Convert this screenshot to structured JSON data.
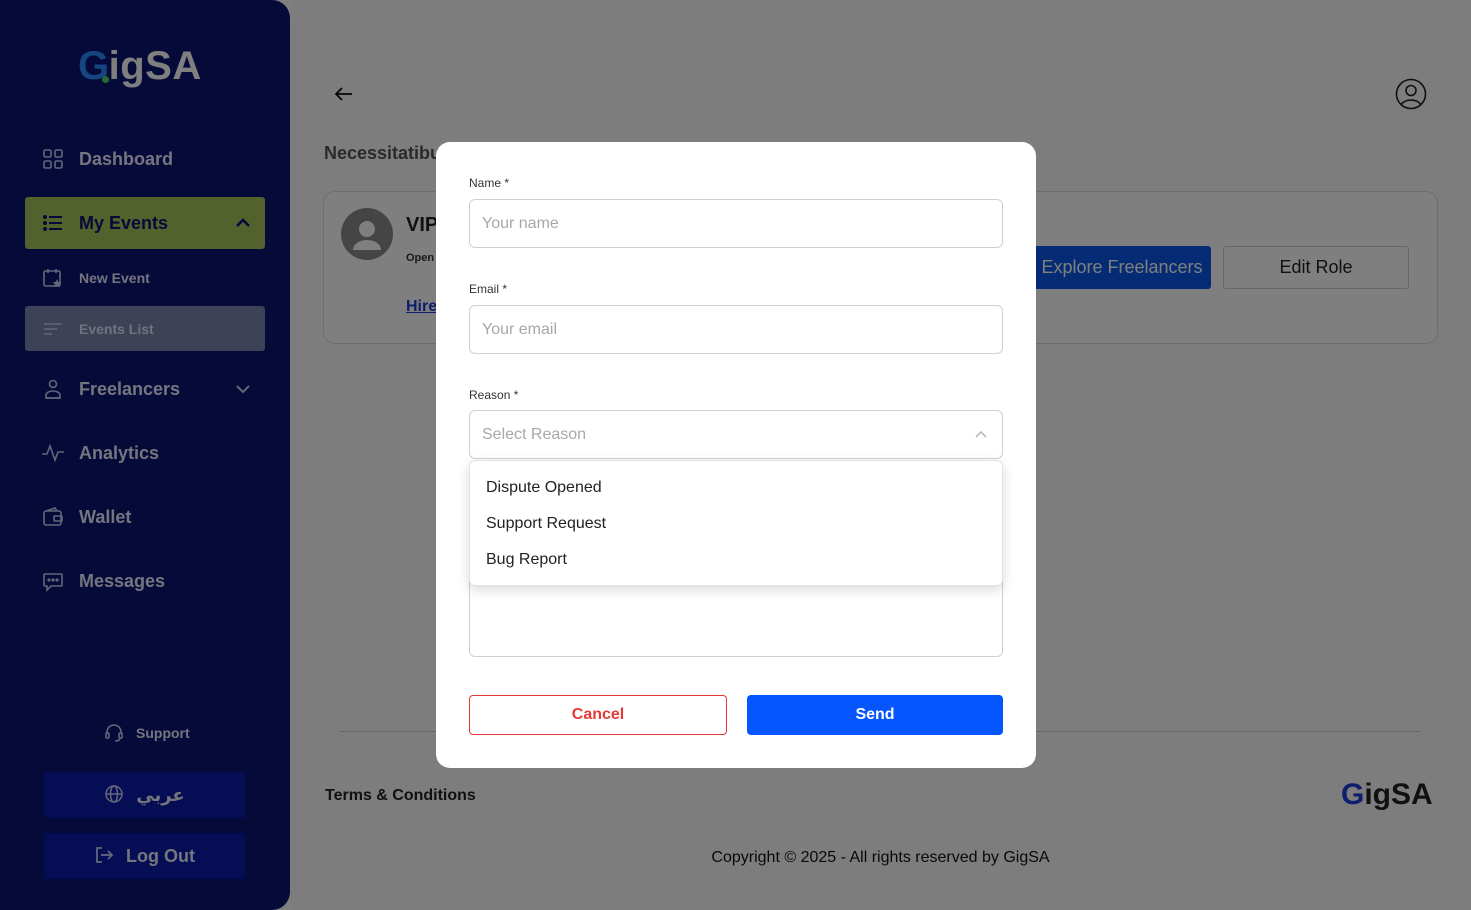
{
  "sidebar": {
    "logo": "GigSA",
    "items": {
      "dashboard": "Dashboard",
      "my_events": "My Events",
      "new_event": "New Event",
      "events_list": "Events List",
      "freelancers": "Freelancers",
      "analytics": "Analytics",
      "wallet": "Wallet",
      "messages": "Messages"
    },
    "support": "Support",
    "language": "عربي",
    "logout": "Log Out"
  },
  "main": {
    "event_title": "Necessitatibu",
    "card": {
      "name": "VIP",
      "status": "Open",
      "link": "Hire",
      "explore_button": "Explore Freelancers",
      "edit_button": "Edit Role"
    },
    "footer": {
      "terms": "Terms & Conditions",
      "logo": "GigSA",
      "copyright": "Copyright © 2025 - All rights reserved by GigSA"
    }
  },
  "modal": {
    "name_label": "Name *",
    "name_placeholder": "Your name",
    "email_label": "Email *",
    "email_placeholder": "Your email",
    "reason_label": "Reason *",
    "reason_placeholder": "Select Reason",
    "reason_options": [
      "Dispute Opened",
      "Support Request",
      "Bug Report"
    ],
    "cancel_label": "Cancel",
    "send_label": "Send"
  },
  "colors": {
    "sidebar_bg": "#0a1472",
    "active_item": "#a7c25a",
    "primary_blue": "#0556ff",
    "cancel_red": "#e53935"
  }
}
